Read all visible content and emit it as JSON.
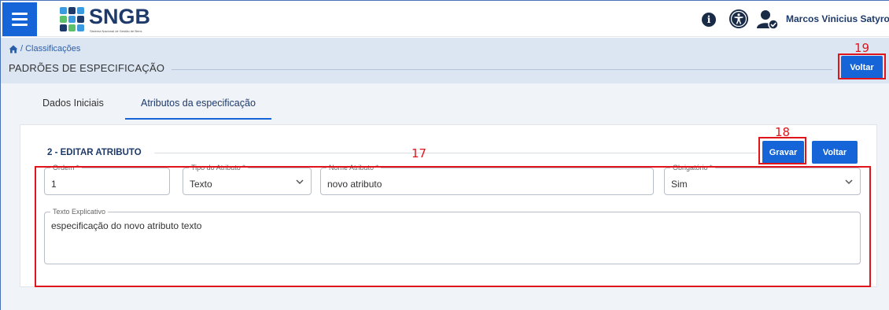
{
  "app": {
    "logo_text": "SNGB",
    "logo_tagline": "Sistema Nacional de Gestão de Bens",
    "user_name": "Marcos Vinicius Satyro C..."
  },
  "header": {
    "breadcrumb": "/ Classificações",
    "title": "PADRÕES DE ESPECIFICAÇÃO",
    "voltar_label": "Voltar"
  },
  "tabs": [
    {
      "label": "Dados Iniciais",
      "active": false
    },
    {
      "label": "Atributos da especificação",
      "active": true
    }
  ],
  "form": {
    "section_title": "2 - EDITAR ATRIBUTO",
    "gravar_label": "Gravar",
    "voltar_label": "Voltar",
    "fields": {
      "ordem": {
        "label": "Ordem *",
        "value": "1"
      },
      "tipo": {
        "label": "Tipo do Atributo *",
        "value": "Texto"
      },
      "nome": {
        "label": "Nome Atributo *",
        "value": "novo atributo"
      },
      "obrigatorio": {
        "label": "Obrigatório *",
        "value": "Sim"
      },
      "texto": {
        "label": "Texto Explicativo",
        "value": "especificação do novo atributo texto"
      }
    }
  },
  "annotations": {
    "n17": "17",
    "n18": "18",
    "n19": "19"
  },
  "colors": {
    "primary": "#1565d8",
    "header_band": "#dce6f3",
    "annotation": "#e0141b",
    "brand_dark": "#1d3a6b"
  },
  "icons": [
    "menu-icon",
    "sngb-logo-mark",
    "info-icon",
    "accessibility-icon",
    "user-check-icon",
    "home-icon",
    "chevron-down-icon"
  ]
}
